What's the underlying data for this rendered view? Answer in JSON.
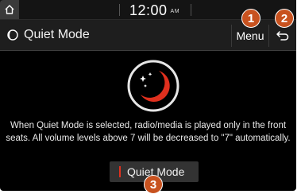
{
  "status_bar": {
    "time": "12:00",
    "ampm": "AM"
  },
  "header": {
    "title": "Quiet Mode",
    "menu_label": "Menu"
  },
  "main": {
    "description_line1": "When Quiet Mode is selected, radio/media is played only in the front",
    "description_line2": "seats. All volume levels above 7 will be decreased to \"7\" automatically.",
    "quiet_mode_button_label": "Quiet Mode"
  },
  "callouts": {
    "menu": "1",
    "back": "2",
    "quiet_mode": "3"
  },
  "colors": {
    "accent_red": "#e0301e",
    "callout_orange": "#c8521f"
  },
  "icons": {
    "home": "home-icon",
    "quiet_mode": "crescent-moon-icon",
    "back": "back-arrow-icon"
  }
}
